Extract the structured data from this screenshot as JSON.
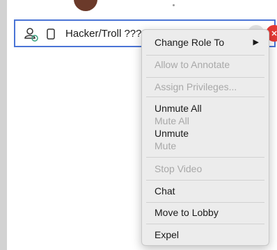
{
  "participant": {
    "name": "Hacker/Troll ???? (Guest)"
  },
  "menu": {
    "change_role": "Change Role To",
    "allow_annotate": "Allow to Annotate",
    "assign_privileges": "Assign Privileges...",
    "unmute_all": "Unmute All",
    "mute_all": "Mute All",
    "unmute": "Unmute",
    "mute": "Mute",
    "stop_video": "Stop Video",
    "chat": "Chat",
    "move_to_lobby": "Move to Lobby",
    "expel": "Expel"
  },
  "colors": {
    "selection_border": "#4a74d6",
    "disabled_text": "#a8a8a8",
    "menu_bg": "#ececec",
    "danger": "#e53935"
  },
  "icons": {
    "submenu": "chevron-right-icon",
    "participant": "user-icon",
    "device": "phone-icon"
  }
}
